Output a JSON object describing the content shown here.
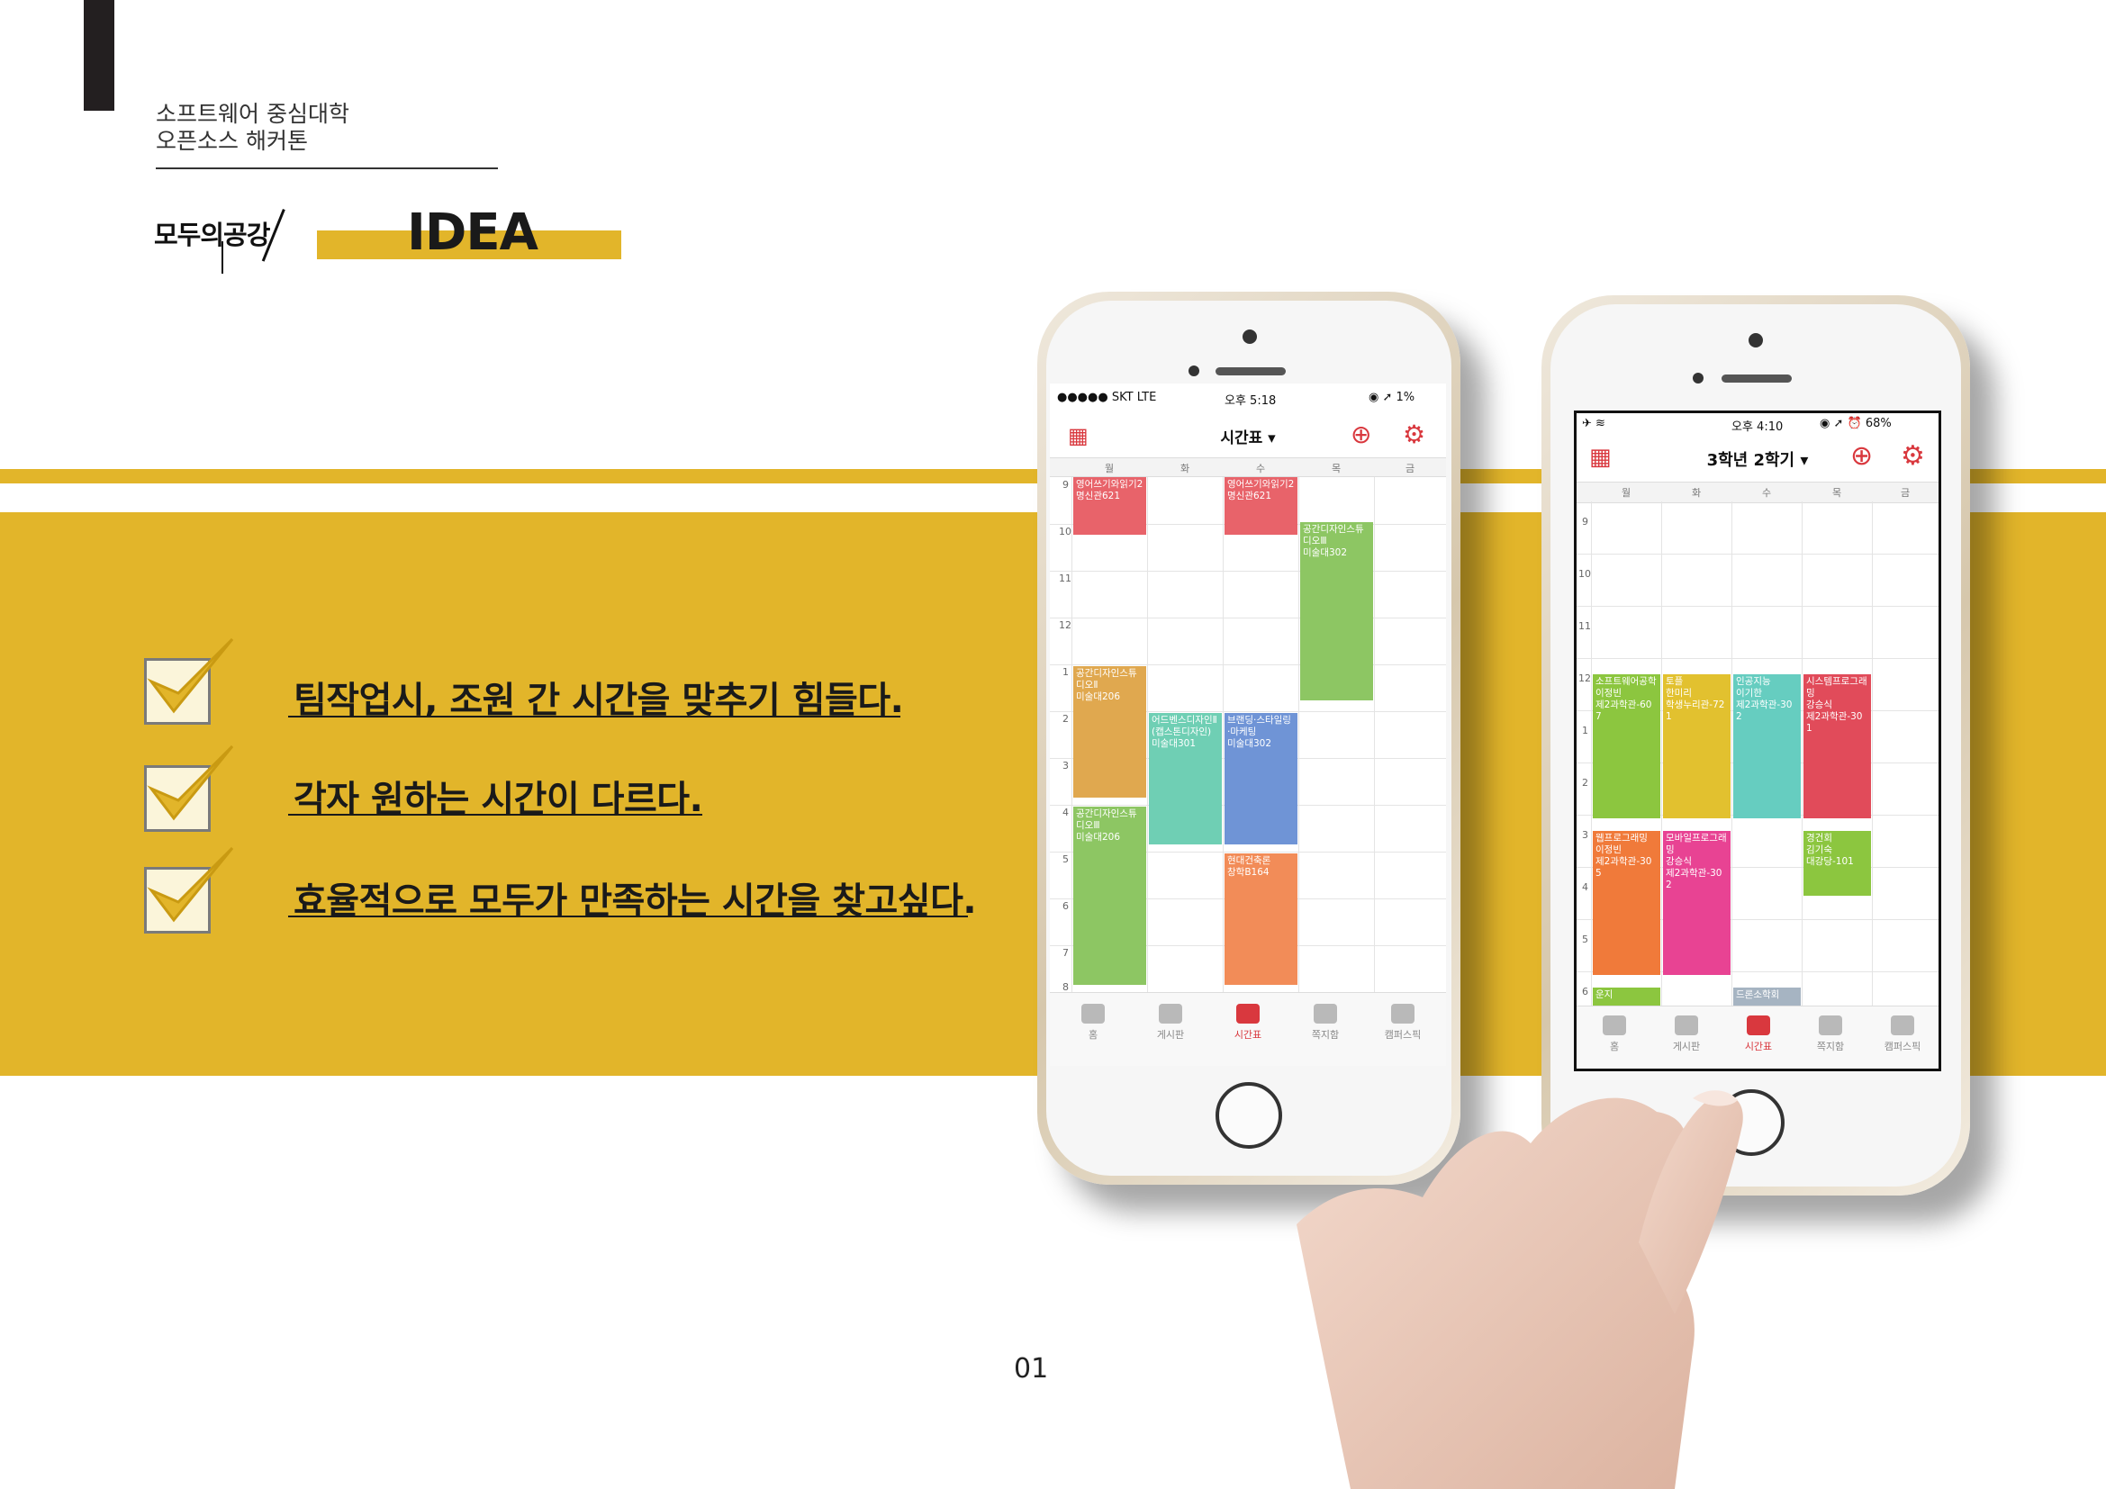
{
  "header": {
    "line1": "소프트웨어 중심대학",
    "line2": "오픈소스 해커톤",
    "logo": "모두의공강",
    "idea": "IDEA"
  },
  "checklist": [
    {
      "text": "팀작업시, 조원 간 시간을 맞추기 힘들다."
    },
    {
      "text": "각자 원하는 시간이 다르다."
    },
    {
      "text": "효율적으로 모두가 만족하는 시간을 찾고싶다."
    }
  ],
  "phone1": {
    "status": {
      "carrier": "●●●●● SKT  LTE",
      "time": "오후 5:18",
      "battery": "◉ ➚ 1%"
    },
    "title": "시간표 ▾",
    "days": [
      "월",
      "화",
      "수",
      "목",
      "금"
    ],
    "hours": [
      "9",
      "10",
      "11",
      "12",
      "1",
      "2",
      "3",
      "4",
      "5",
      "6",
      "7",
      "8"
    ],
    "blocks": [
      {
        "text": "영어쓰기와읽기2\n명신관621",
        "color": "#e8636a"
      },
      {
        "text": "영어쓰기와읽기2\n명신관621",
        "color": "#e8636a"
      },
      {
        "text": "공간디자인스튜\n디오Ⅲ\n미술대302",
        "color": "#8dc663"
      },
      {
        "text": "공간디자인스튜\n디오Ⅱ\n미술대206",
        "color": "#e0a84f"
      },
      {
        "text": "어드벤스디자인Ⅱ\n(캡스톤디자인)\n미술대301",
        "color": "#6fcfb4"
      },
      {
        "text": "브랜딩·스타일링\n·마케팅\n미술대302",
        "color": "#6f94d6"
      },
      {
        "text": "공간디자인스튜\n디오Ⅲ\n미술대206",
        "color": "#8dc663"
      },
      {
        "text": "현대건축론\n창학B164",
        "color": "#f28c58"
      }
    ],
    "tabs": [
      "홈",
      "게시판",
      "시간표",
      "쪽지함",
      "캠퍼스픽"
    ]
  },
  "phone2": {
    "status": {
      "left": "✈ ≋",
      "time": "오후 4:10",
      "battery": "◉ ➚ ⏰ 68%"
    },
    "title": "3학년 2학기 ▾",
    "days": [
      "월",
      "화",
      "수",
      "목",
      "금"
    ],
    "hours": [
      "9",
      "10",
      "11",
      "12",
      "1",
      "2",
      "3",
      "4",
      "5",
      "6"
    ],
    "blocks": [
      {
        "text": "소프트웨어공학\n이정빈\n제2과학관-60\n7",
        "color": "#8cc63f"
      },
      {
        "text": "토플\n한미리\n학생누리관-72\n1",
        "color": "#e2c12f"
      },
      {
        "text": "인공지능\n이기한\n제2과학관-30\n2",
        "color": "#66cdc0"
      },
      {
        "text": "시스템프로그래\n밍\n강승식\n제2과학관-30\n1",
        "color": "#e14b5a"
      },
      {
        "text": "웹프로그래밍\n이정빈\n제2과학관-30\n5",
        "color": "#f07a3a"
      },
      {
        "text": "모바일프로그래\n밍\n강승식\n제2과학관-30\n2",
        "color": "#e84393"
      },
      {
        "text": "경건회\n김기숙\n대강당-101",
        "color": "#8cc63f"
      },
      {
        "text": "운지",
        "color": "#8cc63f"
      },
      {
        "text": "드론소학회",
        "color": "#a6b4c2"
      }
    ],
    "tabs": [
      "홈",
      "게시판",
      "시간표",
      "쪽지함",
      "캠퍼스픽"
    ]
  },
  "page_number": "01"
}
